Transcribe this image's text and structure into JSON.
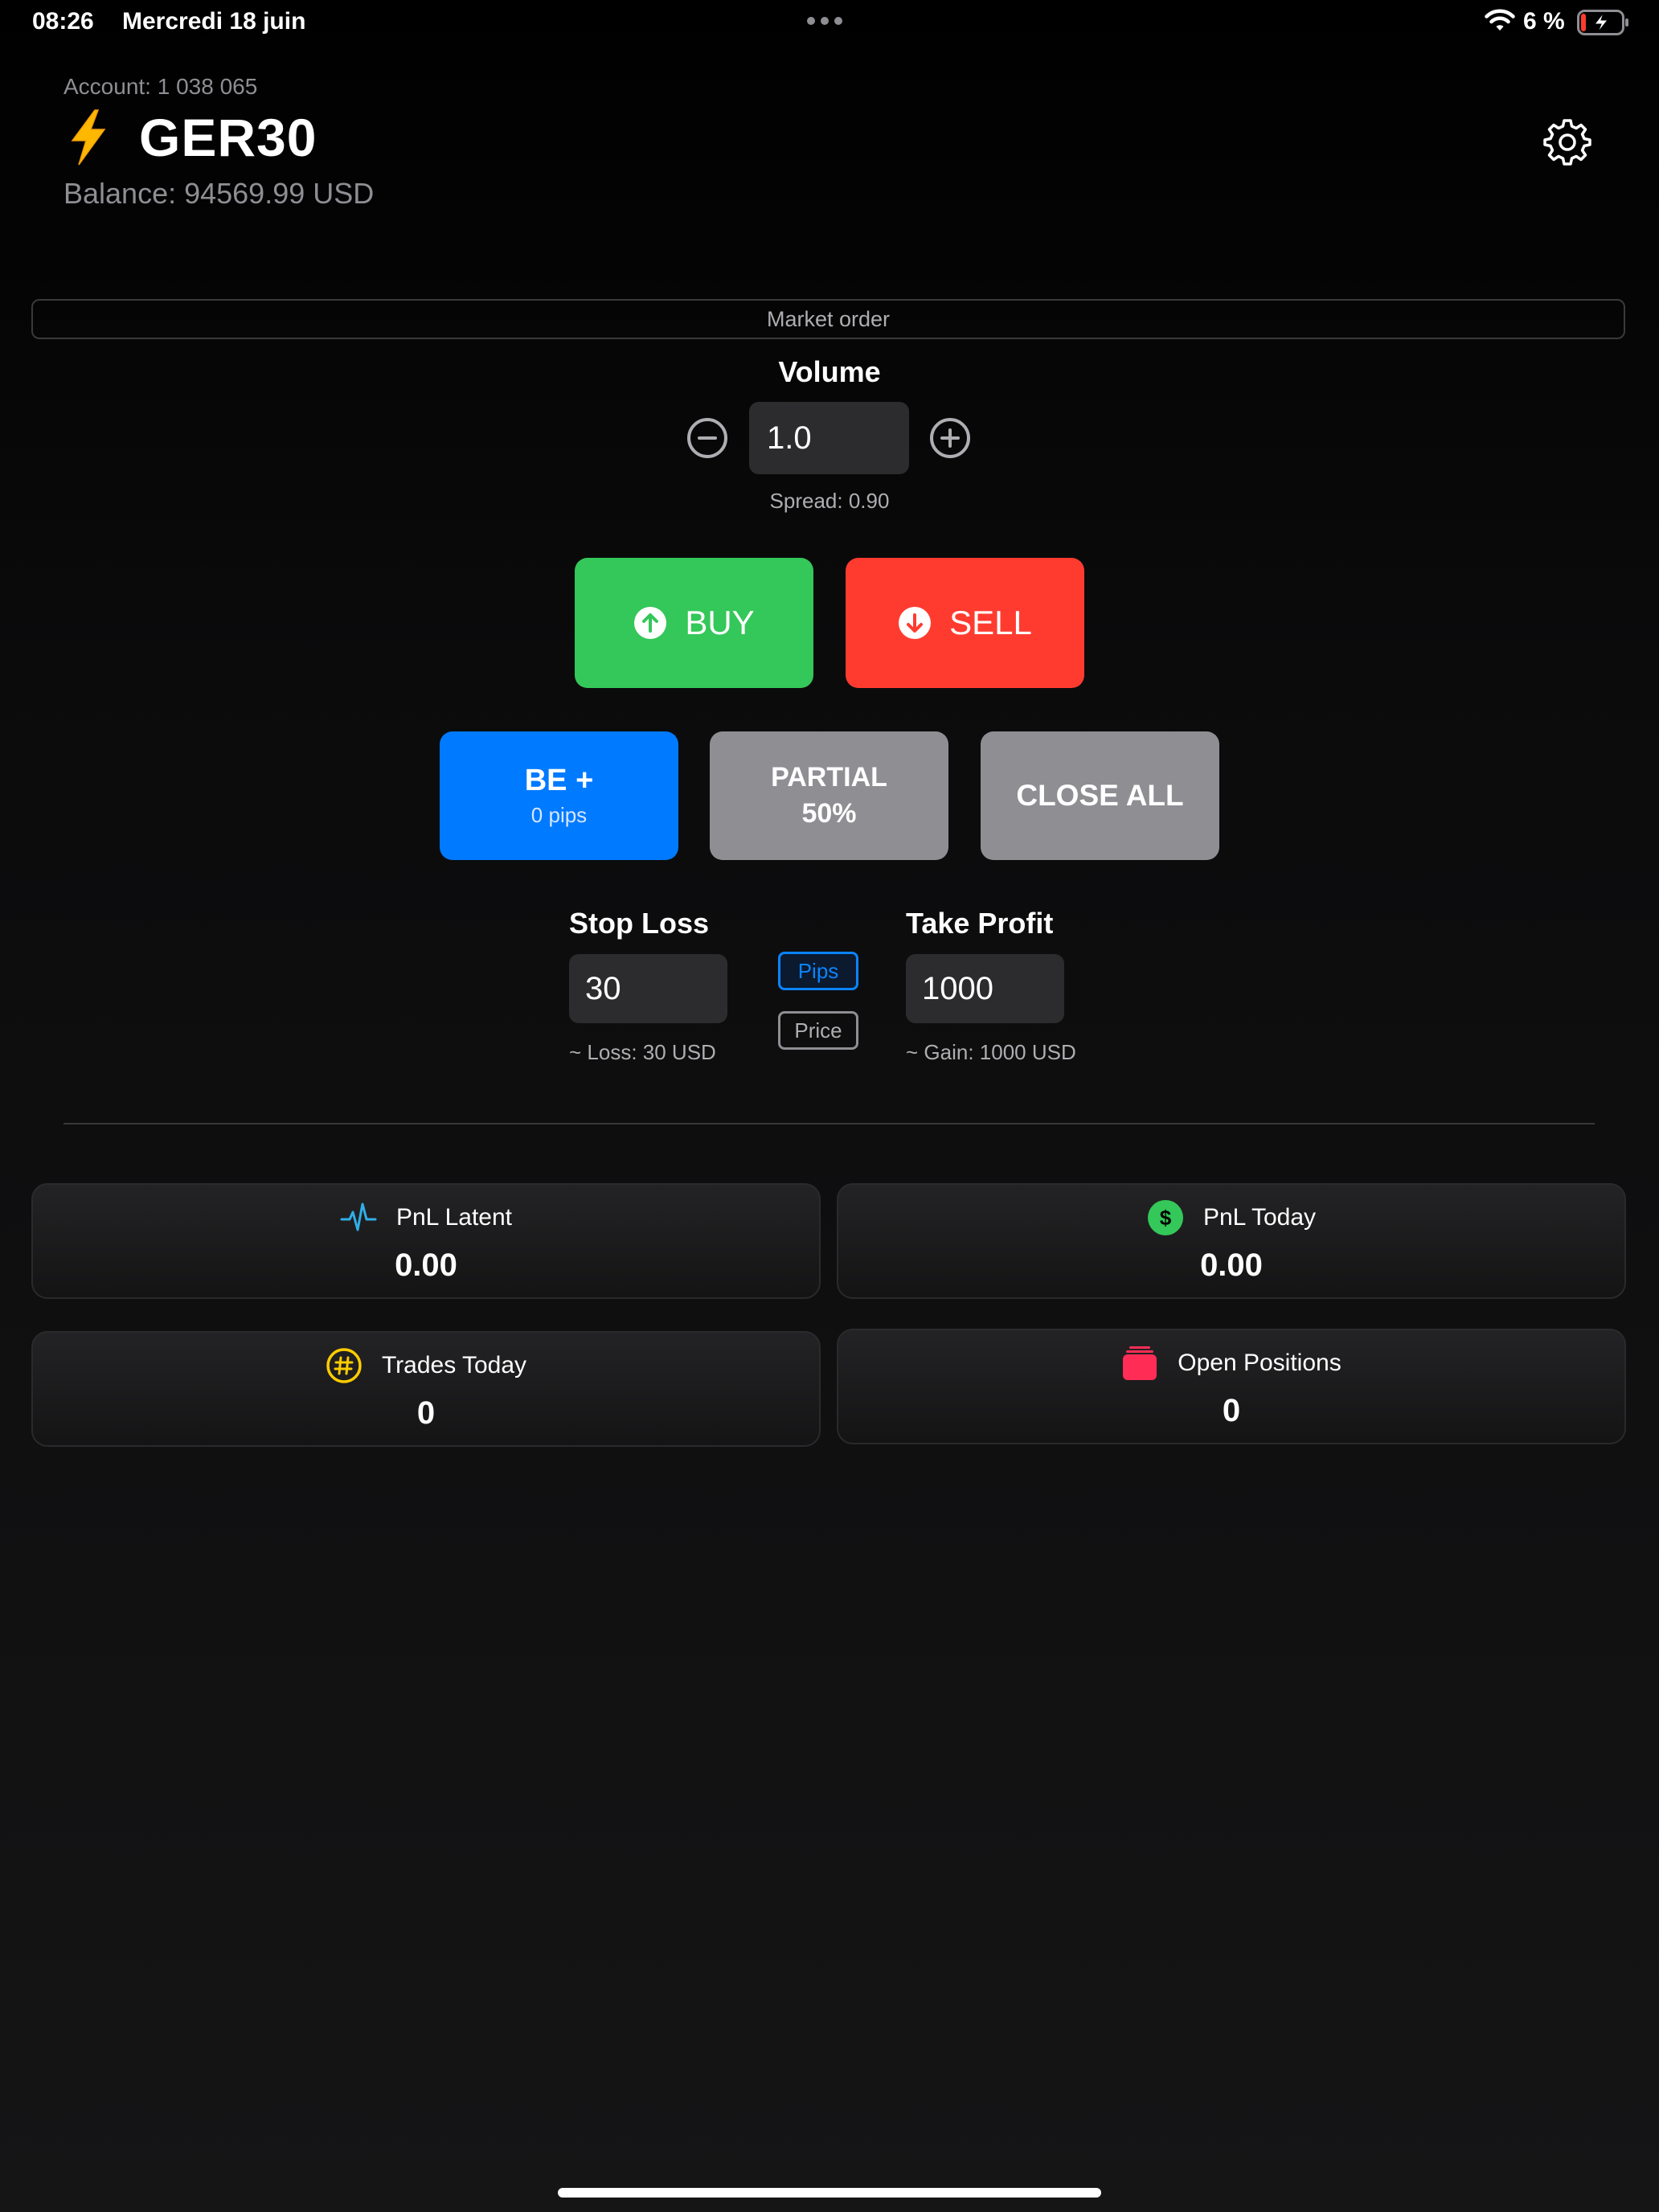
{
  "status_bar": {
    "time": "08:26",
    "date": "Mercredi 18 juin",
    "battery_percent": "6 %"
  },
  "header": {
    "account": "Account: 1 038 065",
    "symbol": "GER30",
    "balance": "Balance: 94569.99 USD"
  },
  "order_type": "Market order",
  "volume": {
    "label": "Volume",
    "value": "1.0",
    "spread": "Spread: 0.90"
  },
  "trade": {
    "buy_label": "BUY",
    "sell_label": "SELL"
  },
  "actions": {
    "be_title": "BE +",
    "be_sub": "0 pips",
    "partial_line1": "PARTIAL",
    "partial_line2": "50%",
    "close_all": "CLOSE ALL"
  },
  "risk": {
    "stop_loss_label": "Stop Loss",
    "stop_loss_value": "30",
    "stop_loss_note": "~ Loss: 30 USD",
    "take_profit_label": "Take Profit",
    "take_profit_value": "1000",
    "take_profit_note": "~ Gain: 1000 USD",
    "mode_pips": "Pips",
    "mode_price": "Price",
    "selected_mode": "Pips"
  },
  "stats": [
    {
      "label": "PnL Latent",
      "value": "0.00",
      "icon": "pulse-icon"
    },
    {
      "label": "PnL Today",
      "value": "0.00",
      "icon": "dollar-icon"
    },
    {
      "label": "Trades Today",
      "value": "0",
      "icon": "number-icon"
    },
    {
      "label": "Open Positions",
      "value": "0",
      "icon": "stack-icon"
    }
  ],
  "colors": {
    "buy": "#34c759",
    "sell": "#ff3b30",
    "be": "#007aff",
    "neutral_button": "#8e8e93",
    "pulse": "#32ade6",
    "dollar": "#34c759",
    "number": "#ffcc00",
    "stack": "#ff2d55"
  }
}
